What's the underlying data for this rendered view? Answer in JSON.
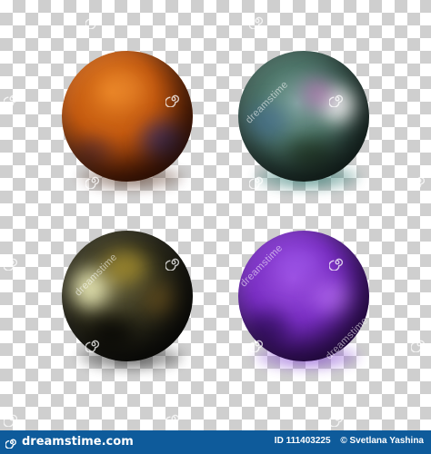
{
  "spheres": [
    {
      "name": "orange",
      "color": "#c45a10"
    },
    {
      "name": "teal",
      "color": "#4c7468"
    },
    {
      "name": "dark-gold",
      "color": "#34321e"
    },
    {
      "name": "purple",
      "color": "#7a2fc4"
    }
  ],
  "watermark": {
    "text": "dreamstime"
  },
  "footer": {
    "logo_text": "dreamstime.com",
    "id_label": "ID 111403225",
    "author": "© Svetlana Yashina"
  },
  "colors": {
    "footer_bg": "#0e5b9b",
    "checker_dark": "#cfcfcf",
    "checker_light": "#ffffff"
  }
}
